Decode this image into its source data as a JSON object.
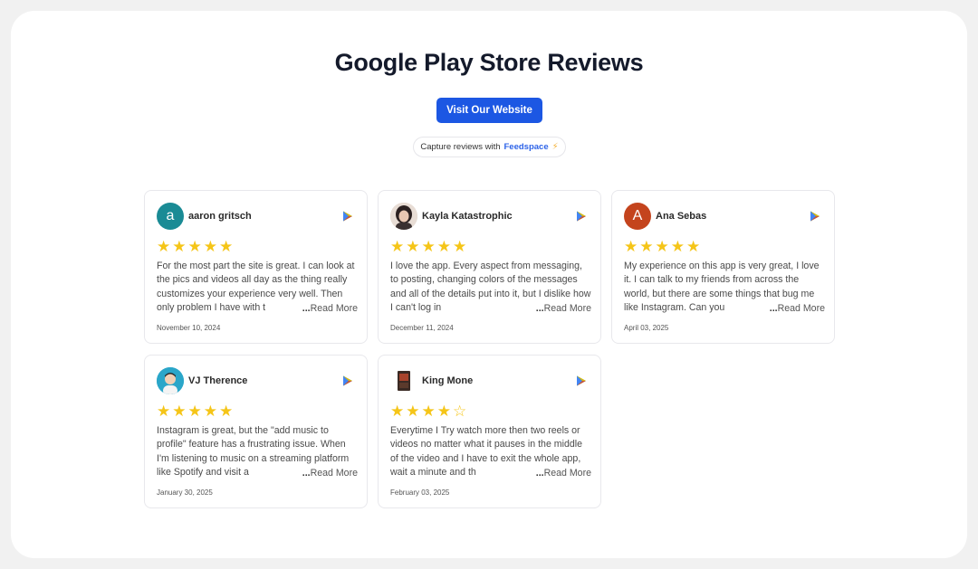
{
  "page": {
    "title": "Google Play Store Reviews",
    "visit_button": "Visit Our Website",
    "capture_prefix": "Capture reviews with",
    "capture_brand": "Feedspace"
  },
  "colors": {
    "accent": "#1c57e3",
    "star": "#f5c518"
  },
  "reviews": [
    {
      "name": "aaron gritsch",
      "avatar_letter": "a",
      "avatar_color": "#1a8b95",
      "stars": "★★★★★",
      "rating": 5,
      "text": "For the most part the site is great. I can look at the pics and videos all day as the thing really customizes your experience very well. Then only problem I have with t",
      "ellipsis": "...",
      "more": "Read More",
      "date": "November 10, 2024"
    },
    {
      "name": "Kayla Katastrophic",
      "avatar_letter": "",
      "avatar_color": "#c9b6a8",
      "stars": "★★★★★",
      "rating": 5,
      "text": "I love the app. Every aspect from messaging, to posting, changing colors of the messages and all of the details put into it, but I dislike how I can't log in",
      "ellipsis": "...",
      "more": "Read More",
      "date": "December 11, 2024"
    },
    {
      "name": "Ana Sebas",
      "avatar_letter": "A",
      "avatar_color": "#c4441d",
      "stars": "★★★★★",
      "rating": 5,
      "text": "My experience on this app is very great, I love it. I can talk to my friends from across the world, but there are some things that bug me like Instagram. Can you",
      "ellipsis": "...",
      "more": "Read More",
      "date": "April 03, 2025"
    },
    {
      "name": "VJ Therence",
      "avatar_letter": "",
      "avatar_color": "#2aa6c9",
      "stars": "★★★★★",
      "rating": 5,
      "text": "Instagram is great, but the \"add music to profile\" feature has a frustrating issue. When I'm listening to music on a streaming platform like Spotify and visit a",
      "ellipsis": "...",
      "more": "Read More",
      "date": "January 30, 2025"
    },
    {
      "name": "King Mone",
      "avatar_letter": "",
      "avatar_color": "#ffffff",
      "stars": "★★★★☆",
      "rating": 4,
      "text": "Everytime I Try watch more then two reels or videos no matter what it pauses in the middle of the video and I have to exit the whole app, wait a minute and th",
      "ellipsis": "...",
      "more": "Read More",
      "date": "February 03, 2025"
    }
  ]
}
